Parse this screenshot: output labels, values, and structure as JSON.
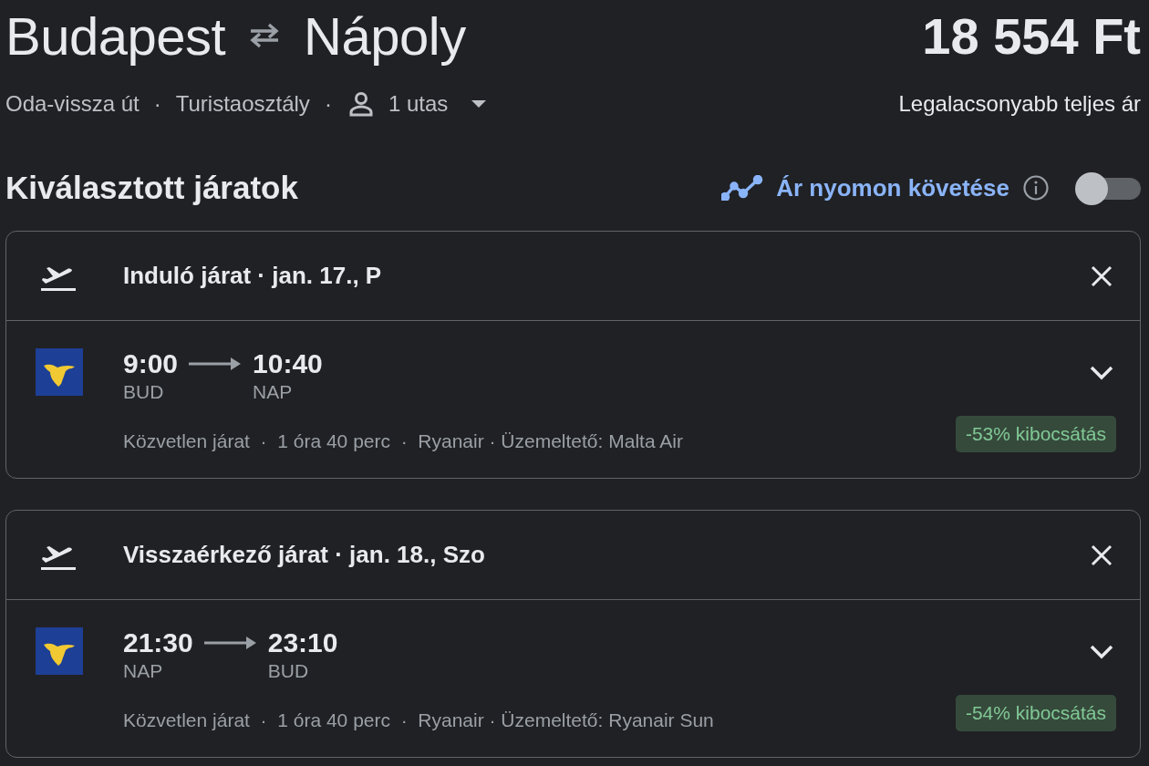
{
  "route": {
    "origin": "Budapest",
    "destination": "Nápoly"
  },
  "price": "18 554 Ft",
  "price_note": "Legalacsonyabb teljes ár",
  "trip_meta": [
    {
      "kind": "text",
      "text": "Oda-vissza út"
    },
    {
      "kind": "separator",
      "text": "·"
    },
    {
      "kind": "text",
      "text": "Turistaosztály"
    },
    {
      "kind": "separator",
      "text": "·"
    },
    {
      "kind": "passengers",
      "text": "1 utas"
    }
  ],
  "section_title": "Kiválasztott járatok",
  "price_tracking": {
    "label": "Ár nyomon követése",
    "on": false
  },
  "flights": [
    {
      "header": "Induló járat · jan. 17., P",
      "depart_time": "9:00",
      "arrive_time": "10:40",
      "depart_code": "BUD",
      "arrive_code": "NAP",
      "details": "Közvetlen járat  ·  1 óra 40 perc  ·  Ryanair · Üzemeltető: Malta Air",
      "emissions": "-53% kibocsátás",
      "expanded": false
    },
    {
      "header": "Visszaérkező járat · jan. 18., Szo",
      "depart_time": "21:30",
      "arrive_time": "23:10",
      "depart_code": "NAP",
      "arrive_code": "BUD",
      "details": "Közvetlen járat  ·  1 óra 40 perc  ·  Ryanair · Üzemeltető: Ryanair Sun",
      "emissions": "-54% kibocsátás",
      "expanded": false
    }
  ]
}
